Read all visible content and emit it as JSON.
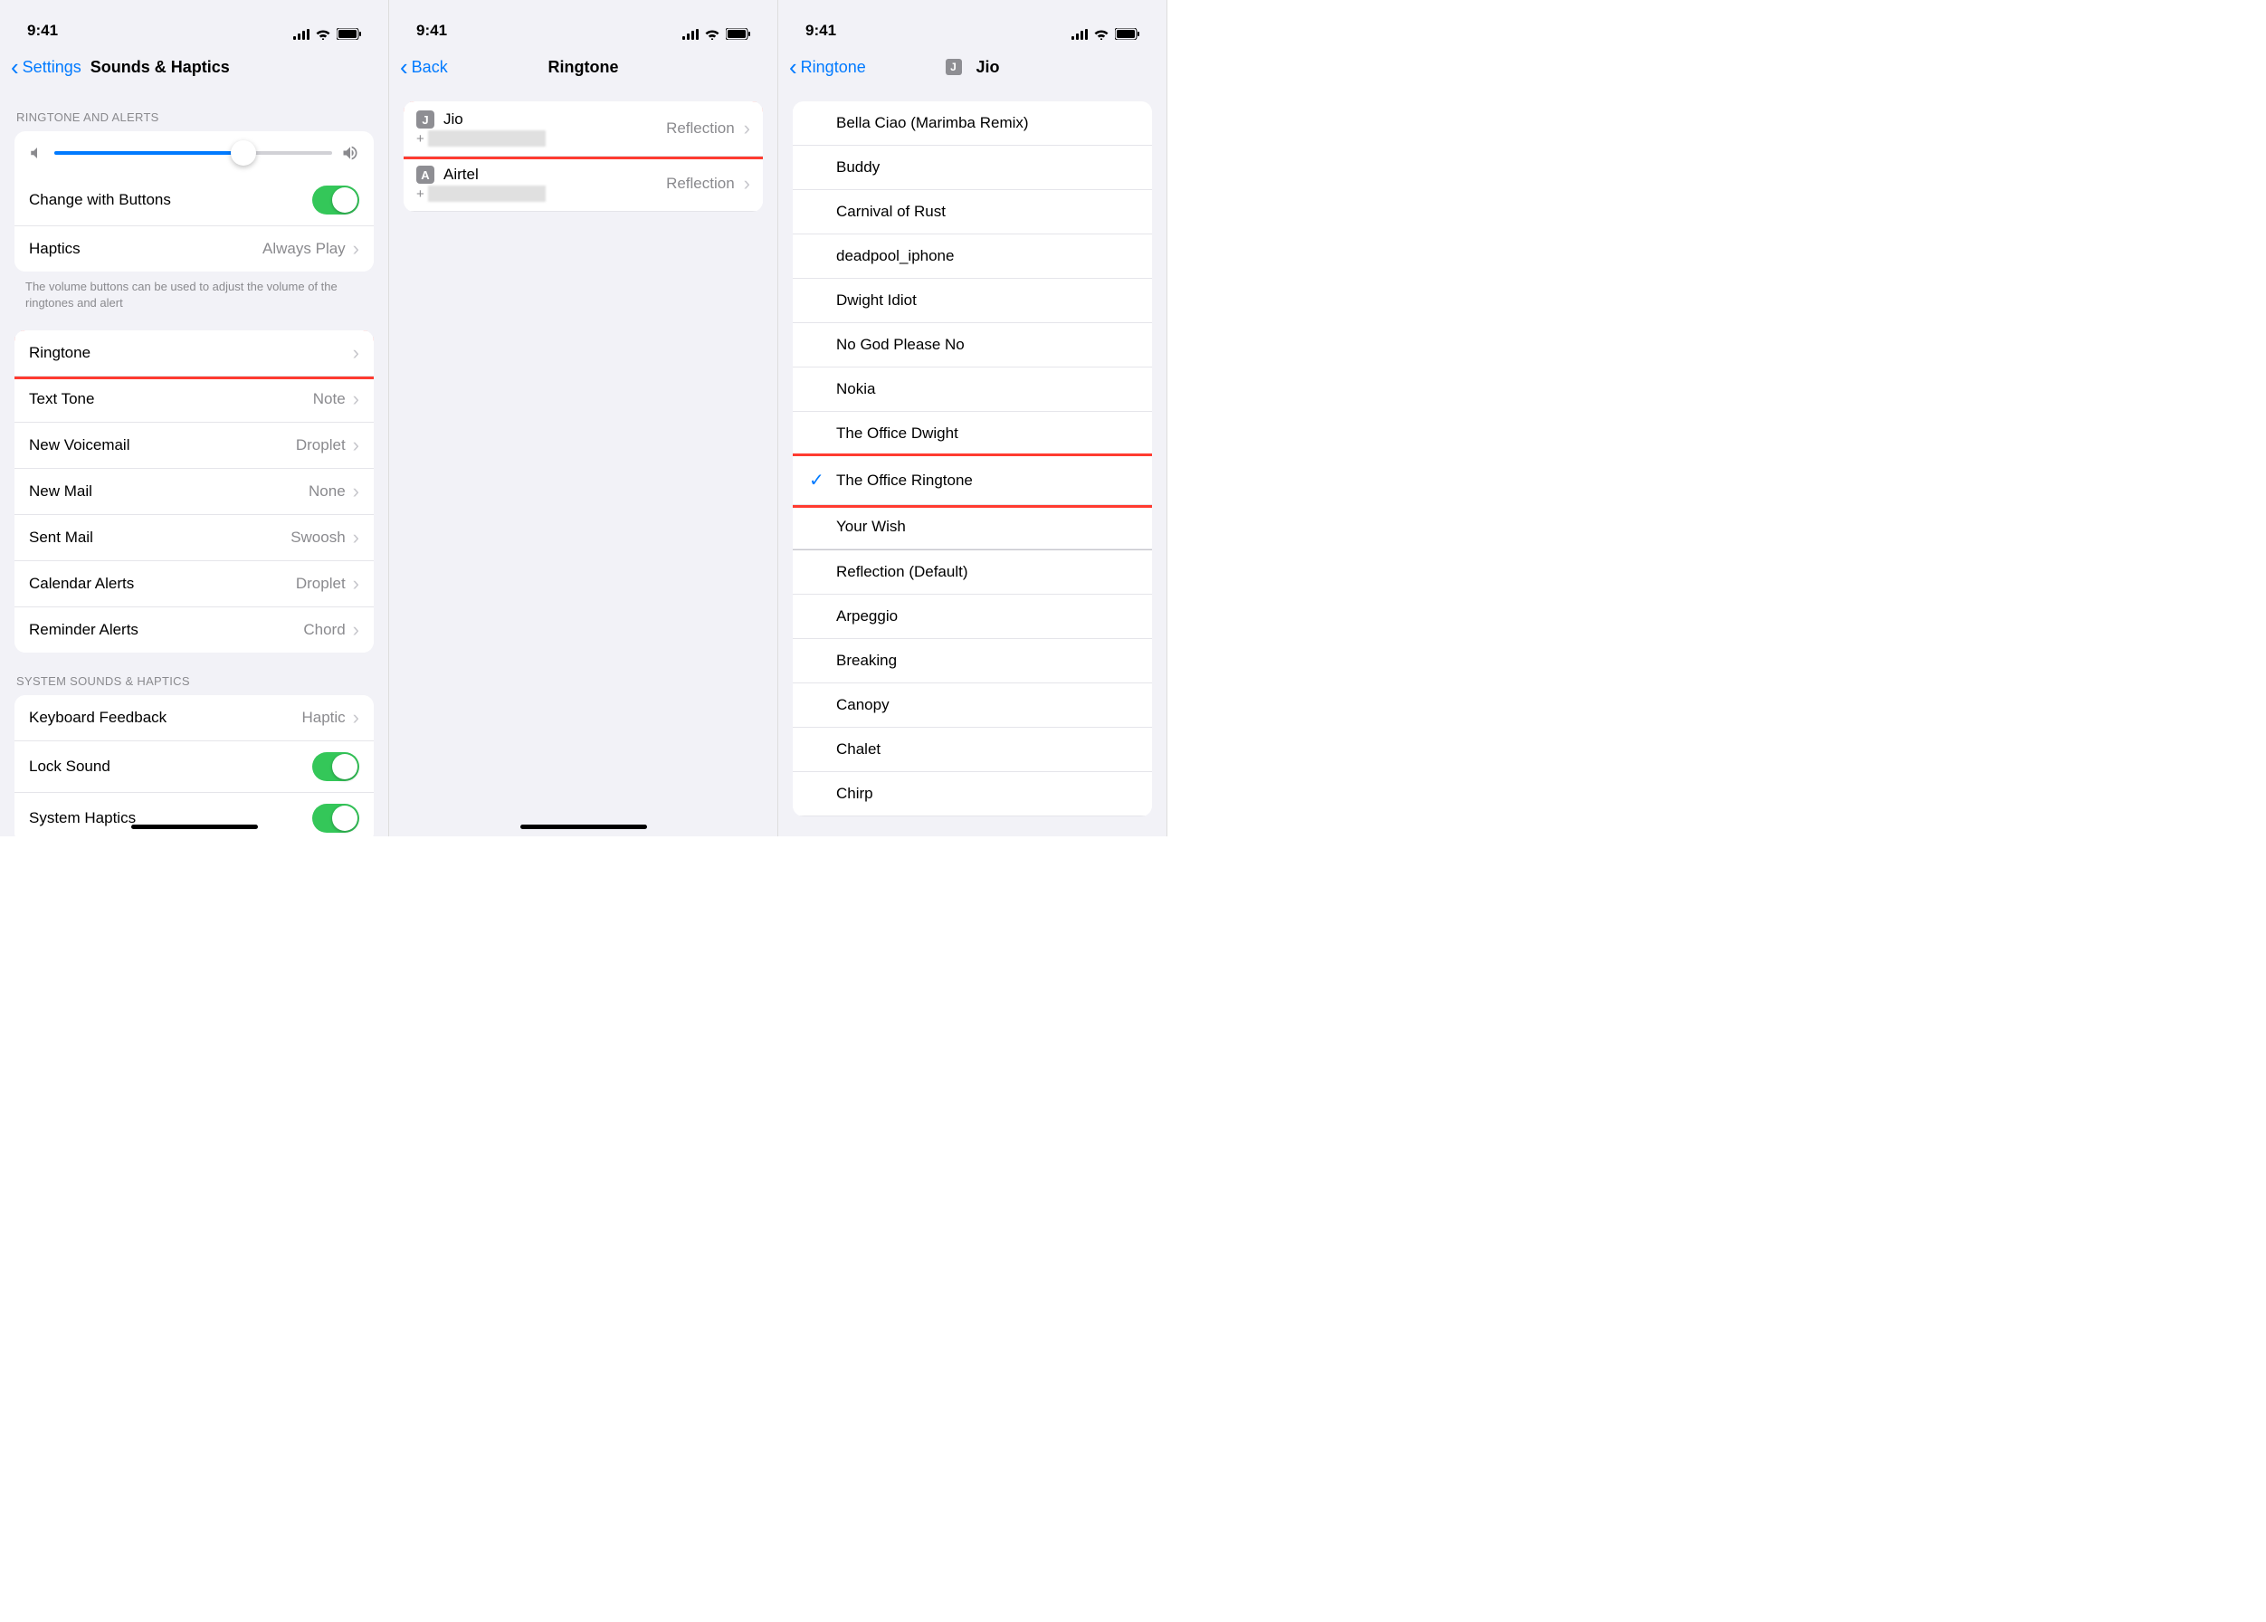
{
  "status": {
    "time": "9:41"
  },
  "screen1": {
    "nav": {
      "back": "Settings",
      "title": "Sounds & Haptics"
    },
    "section1_header": "RINGTONE AND ALERTS",
    "change_buttons": "Change with Buttons",
    "haptics_label": "Haptics",
    "haptics_value": "Always Play",
    "footer": "The volume buttons can be used to adjust the volume of the ringtones and alert",
    "sounds": [
      {
        "label": "Ringtone",
        "value": "",
        "hl": true
      },
      {
        "label": "Text Tone",
        "value": "Note"
      },
      {
        "label": "New Voicemail",
        "value": "Droplet"
      },
      {
        "label": "New Mail",
        "value": "None"
      },
      {
        "label": "Sent Mail",
        "value": "Swoosh"
      },
      {
        "label": "Calendar Alerts",
        "value": "Droplet"
      },
      {
        "label": "Reminder Alerts",
        "value": "Chord"
      }
    ],
    "section2_header": "SYSTEM SOUNDS & HAPTICS",
    "keyboard_label": "Keyboard Feedback",
    "keyboard_value": "Haptic",
    "lock_sound": "Lock Sound",
    "system_haptics": "System Haptics"
  },
  "screen2": {
    "nav": {
      "back": "Back",
      "title": "Ringtone"
    },
    "sims": [
      {
        "badge": "J",
        "name": "Jio",
        "value": "Reflection",
        "hl": true
      },
      {
        "badge": "A",
        "name": "Airtel",
        "value": "Reflection"
      }
    ]
  },
  "screen3": {
    "nav": {
      "back": "Ringtone",
      "badge": "J",
      "title": "Jio"
    },
    "tones_custom": [
      "Bella Ciao (Marimba Remix)",
      "Buddy",
      "Carnival of Rust",
      "deadpool_iphone",
      "Dwight Idiot",
      "No God Please No",
      "Nokia",
      "The Office Dwight",
      "The Office Ringtone",
      "Your Wish"
    ],
    "tones_builtin": [
      "Reflection (Default)",
      "Arpeggio",
      "Breaking",
      "Canopy",
      "Chalet",
      "Chirp"
    ],
    "selected": "The Office Ringtone",
    "highlighted": "The Office Ringtone"
  }
}
